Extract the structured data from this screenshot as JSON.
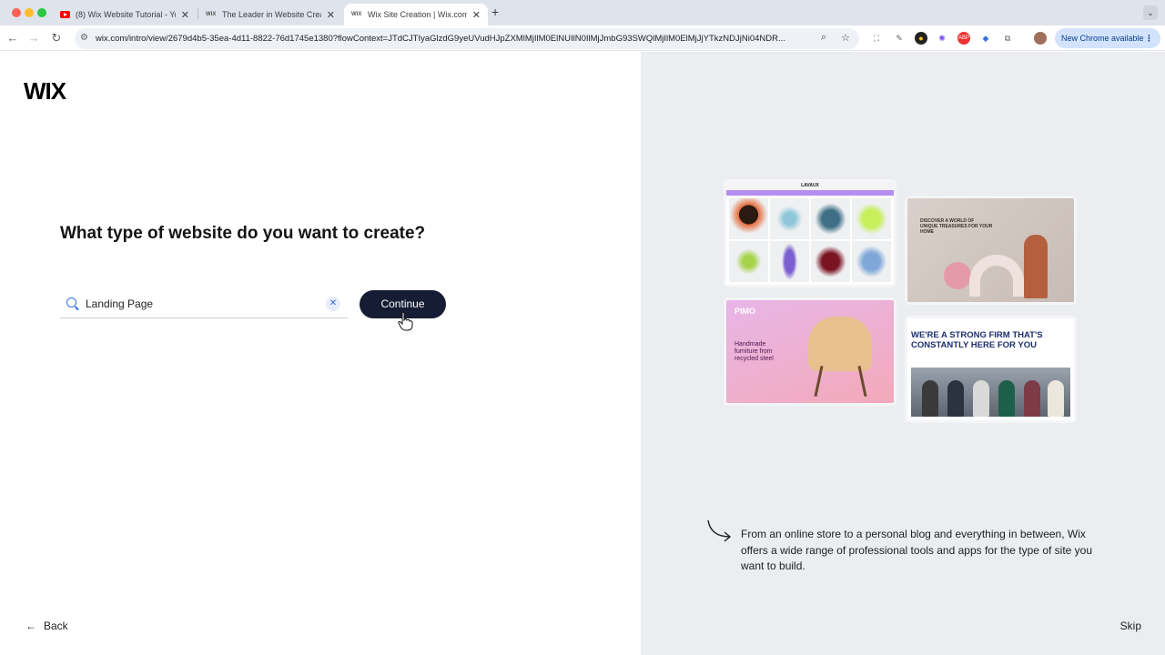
{
  "browser": {
    "tabs": [
      {
        "title": "(8) Wix Website Tutorial - Yo",
        "icon": "youtube-icon",
        "active": false
      },
      {
        "title": "The Leader in Website Creati",
        "icon": "wix-favicon-icon",
        "active": false
      },
      {
        "title": "Wix Site Creation | Wix.com",
        "icon": "wix-favicon-icon",
        "active": true
      }
    ],
    "url": "wix.com/intro/view/2679d4b5-35ea-4d11-8822-76d1745e1380?flowContext=JTdCJTIyaGlzdG9yeUVudHJpZXMlMjIlM0ElNUIlN0IlMjJmbG93SWQlMjIlM0ElMjJjYTkzNDJjNi04NDR...",
    "update_label": "New Chrome available"
  },
  "page": {
    "logo": "WIX",
    "headline": "What type of website do you want to create?",
    "search": {
      "value": "Landing Page"
    },
    "continue_label": "Continue",
    "back_label": "Back",
    "skip_label": "Skip",
    "caption": "From an online store to a personal blog and everything in between, Wix offers a wide range of professional tools and apps for the type of site you want to build."
  },
  "previews": {
    "tile1": {
      "brand": "LAVAUX"
    },
    "tile2": {
      "text": "DISCOVER A WORLD OF UNIQUE TREASURES FOR YOUR HOME"
    },
    "tile3": {
      "brand": "PIMO",
      "text": "Handmade furniture from recycled steel"
    },
    "tile4": {
      "text": "WE'RE A STRONG FIRM THAT'S CONSTANTLY HERE FOR YOU"
    }
  }
}
